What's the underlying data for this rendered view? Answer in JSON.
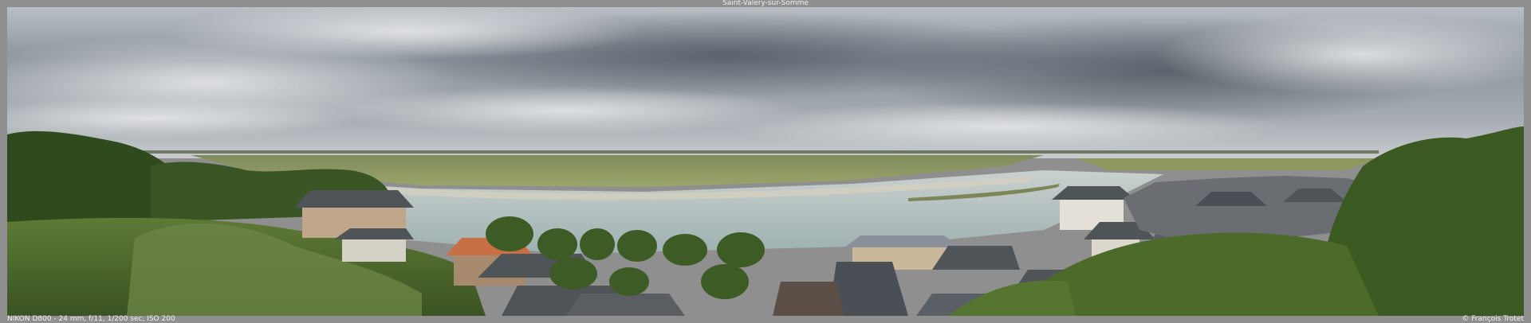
{
  "image": {
    "title": "Saint-Valery-sur-Somme",
    "camera_info": "NIKON D800 - 24 mm, f/11, 1/200 sec, ISO 200",
    "credit": "© François Trotet"
  },
  "colors": {
    "frame": "#8f8f8f",
    "sky_top": "#c9cdd3",
    "sky_dark": "#5f6670",
    "water": "#b9c4c4",
    "marsh": "#8a9560",
    "foliage": "#4e6a2c",
    "roof": "#4f5459"
  }
}
